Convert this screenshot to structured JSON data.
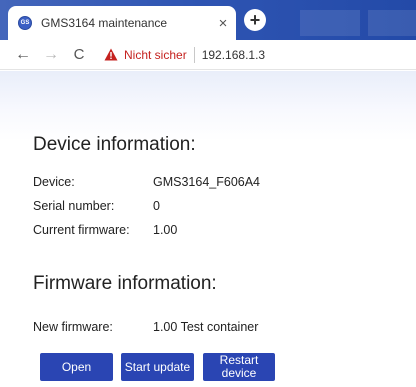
{
  "browser": {
    "tab": {
      "title": "GMS3164 maintenance",
      "favicon": "GS",
      "close": "×"
    },
    "new_tab": "+",
    "toolbar": {
      "back": "←",
      "forward": "→",
      "reload": "C",
      "security_label": "Nicht sicher",
      "url": "192.168.1.3"
    }
  },
  "device_info": {
    "heading": "Device information:",
    "rows": [
      {
        "label": "Device:",
        "value": "GMS3164_F606A4"
      },
      {
        "label": "Serial number:",
        "value": "0"
      },
      {
        "label": "Current firmware:",
        "value": "1.00"
      }
    ]
  },
  "firmware_info": {
    "heading": "Firmware information:",
    "rows": [
      {
        "label": "New firmware:",
        "value": "1.00 Test container"
      }
    ]
  },
  "actions": {
    "open": "Open",
    "start_update": "Start update",
    "restart_line1": "Restart",
    "restart_line2": "device"
  },
  "colors": {
    "button_bg": "#2a45b3",
    "tabstrip": "#2f55b3",
    "security_warning": "#c5221f"
  }
}
